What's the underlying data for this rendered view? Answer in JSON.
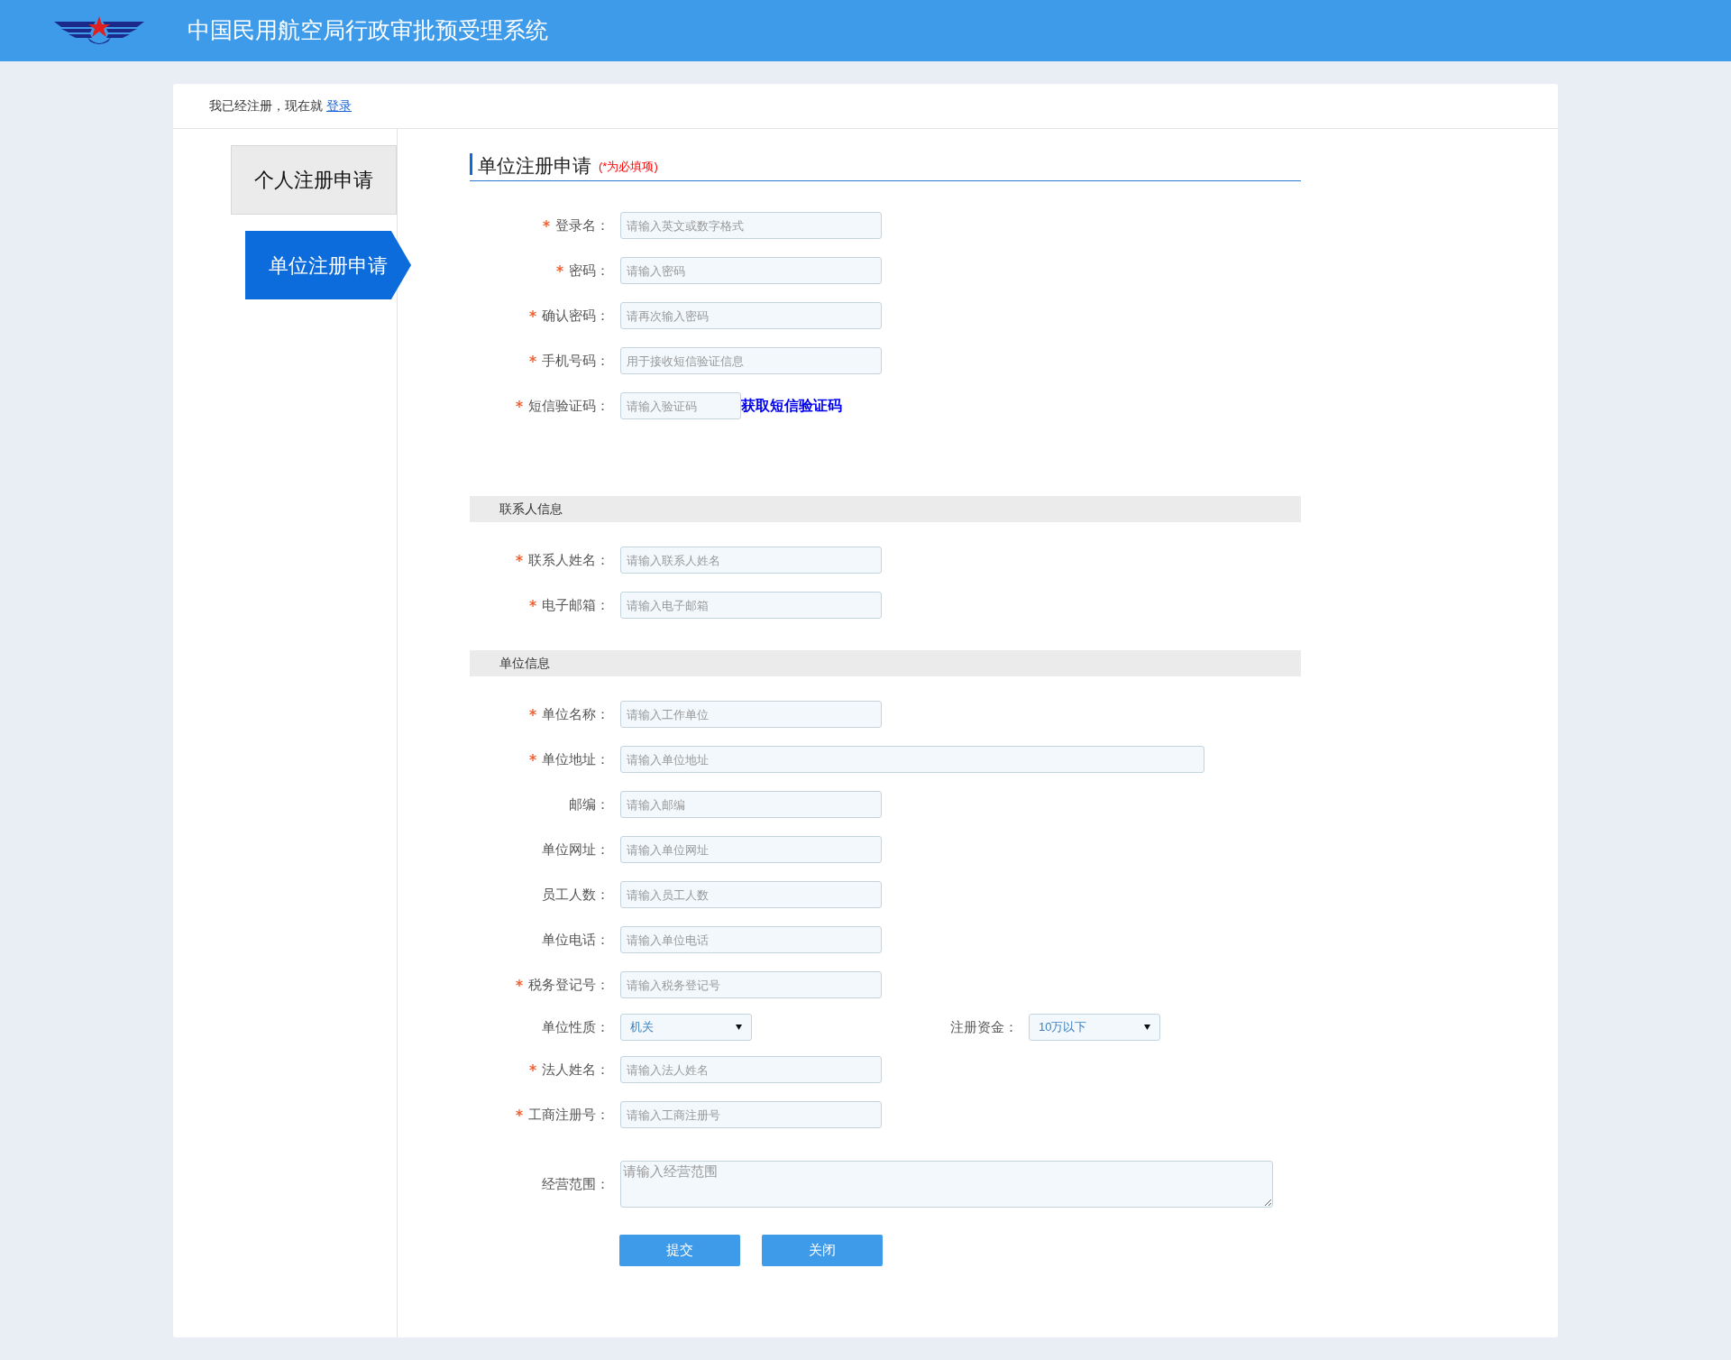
{
  "header": {
    "title": "中国民用航空局行政审批预受理系统"
  },
  "login_prompt": {
    "text": "我已经注册，现在就",
    "link": "登录"
  },
  "sidebar": {
    "tabs": [
      {
        "label": "个人注册申请",
        "selected": false
      },
      {
        "label": "单位注册申请",
        "selected": true
      }
    ]
  },
  "form": {
    "title": "单位注册申请",
    "required_note": "(*为必填项)",
    "sections": [
      {
        "fields": [
          {
            "kind": "input",
            "label": "登录名：",
            "required": true,
            "placeholder": "请输入英文或数字格式"
          },
          {
            "kind": "input",
            "label": "密码：",
            "required": true,
            "placeholder": "请输入密码"
          },
          {
            "kind": "input",
            "label": "确认密码：",
            "required": true,
            "placeholder": "请再次输入密码"
          },
          {
            "kind": "input",
            "label": "手机号码：",
            "required": true,
            "placeholder": "用于接收短信验证信息"
          },
          {
            "kind": "code",
            "label": "短信验证码：",
            "required": true,
            "placeholder": "请输入验证码",
            "link": "获取短信验证码"
          }
        ]
      },
      {
        "heading": "联系人信息",
        "fields": [
          {
            "kind": "input",
            "label": "联系人姓名：",
            "required": true,
            "placeholder": "请输入联系人姓名"
          },
          {
            "kind": "input",
            "label": "电子邮箱：",
            "required": true,
            "placeholder": "请输入电子邮箱"
          }
        ]
      },
      {
        "heading": "单位信息",
        "fields": [
          {
            "kind": "input",
            "label": "单位名称：",
            "required": true,
            "placeholder": "请输入工作单位"
          },
          {
            "kind": "wide",
            "label": "单位地址：",
            "required": true,
            "placeholder": "请输入单位地址"
          },
          {
            "kind": "input",
            "label": "邮编：",
            "required": false,
            "placeholder": "请输入邮编"
          },
          {
            "kind": "input",
            "label": "单位网址：",
            "required": false,
            "placeholder": "请输入单位网址"
          },
          {
            "kind": "input",
            "label": "员工人数：",
            "required": false,
            "placeholder": "请输入员工人数"
          },
          {
            "kind": "input",
            "label": "单位电话：",
            "required": false,
            "placeholder": "请输入单位电话"
          },
          {
            "kind": "input",
            "label": "税务登记号：",
            "required": true,
            "placeholder": "请输入税务登记号"
          },
          {
            "kind": "selects",
            "items": [
              {
                "label": "单位性质：",
                "value": "机关"
              },
              {
                "label": "注册资金：",
                "value": "10万以下"
              }
            ]
          },
          {
            "kind": "input",
            "label": "法人姓名：",
            "required": true,
            "placeholder": "请输入法人姓名"
          },
          {
            "kind": "input",
            "label": "工商注册号：",
            "required": true,
            "placeholder": "请输入工商注册号"
          },
          {
            "kind": "textarea",
            "label": "经营范围：",
            "required": false,
            "placeholder": "请输入经营范围"
          }
        ]
      }
    ],
    "buttons": [
      "提交",
      "关闭"
    ]
  }
}
